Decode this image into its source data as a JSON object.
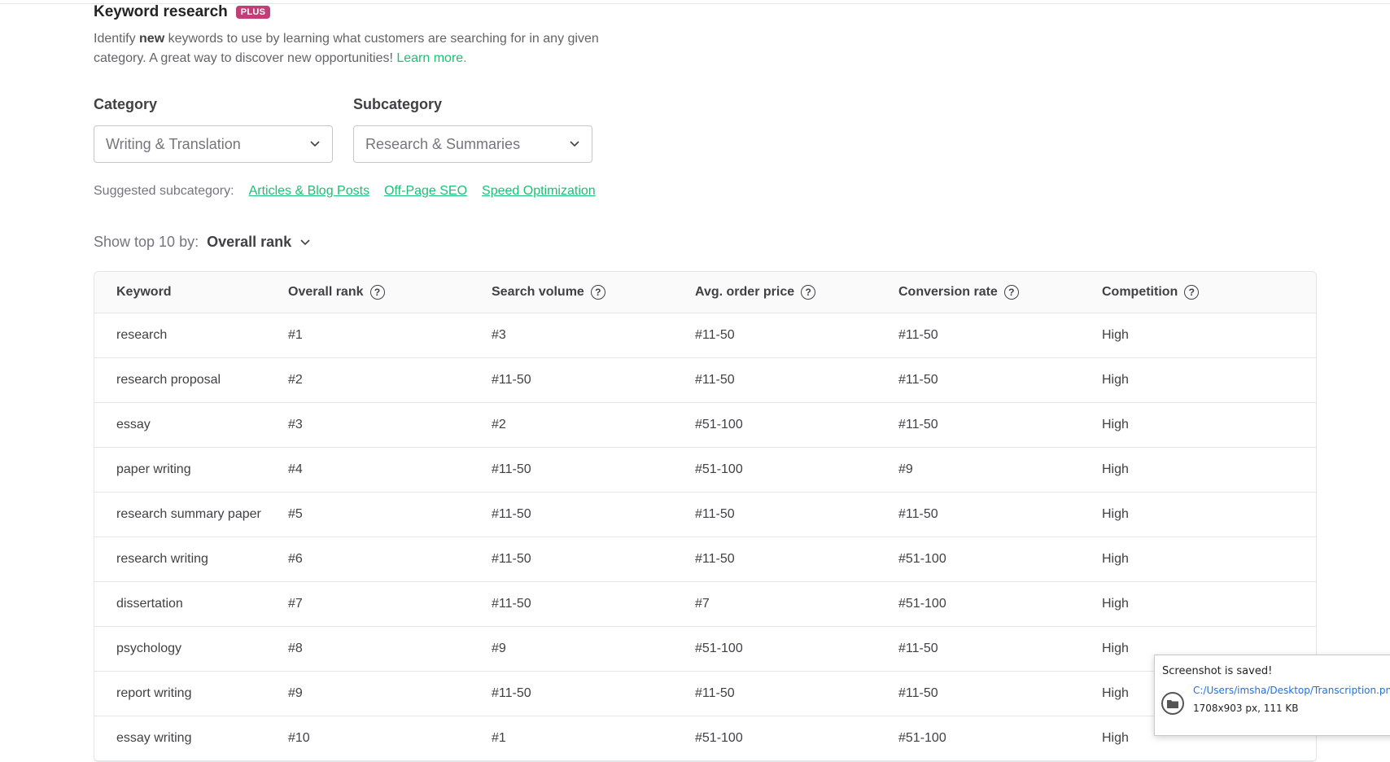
{
  "header": {
    "title": "Keyword research",
    "badge": "PLUS"
  },
  "description": {
    "part1": "Identify ",
    "bold": "new",
    "part2": " keywords to use by learning what customers are searching for in any given category. A great way to discover new opportunities! ",
    "learn_more": "Learn more."
  },
  "category": {
    "label": "Category",
    "value": "Writing & Translation"
  },
  "subcategory": {
    "label": "Subcategory",
    "value": "Research & Summaries"
  },
  "suggested": {
    "label": "Suggested subcategory:",
    "links": [
      "Articles & Blog Posts",
      "Off-Page SEO",
      "Speed Optimization"
    ]
  },
  "sort": {
    "label": "Show top 10 by:",
    "value": "Overall rank"
  },
  "table": {
    "columns": [
      "Keyword",
      "Overall rank",
      "Search volume",
      "Avg. order price",
      "Conversion rate",
      "Competition"
    ],
    "rows": [
      [
        "research",
        "#1",
        "#3",
        "#11-50",
        "#11-50",
        "High"
      ],
      [
        "research proposal",
        "#2",
        "#11-50",
        "#11-50",
        "#11-50",
        "High"
      ],
      [
        "essay",
        "#3",
        "#2",
        "#51-100",
        "#11-50",
        "High"
      ],
      [
        "paper writing",
        "#4",
        "#11-50",
        "#51-100",
        "#9",
        "High"
      ],
      [
        "research summary paper",
        "#5",
        "#11-50",
        "#11-50",
        "#11-50",
        "High"
      ],
      [
        "research writing",
        "#6",
        "#11-50",
        "#11-50",
        "#51-100",
        "High"
      ],
      [
        "dissertation",
        "#7",
        "#11-50",
        "#7",
        "#51-100",
        "High"
      ],
      [
        "psychology",
        "#8",
        "#9",
        "#51-100",
        "#11-50",
        "High"
      ],
      [
        "report writing",
        "#9",
        "#11-50",
        "#11-50",
        "#11-50",
        "High"
      ],
      [
        "essay writing",
        "#10",
        "#1",
        "#51-100",
        "#51-100",
        "High"
      ]
    ]
  },
  "toast": {
    "title": "Screenshot is saved!",
    "path": "C:/Users/imsha/Desktop/Transcription.png",
    "meta": "1708x903 px, 111 KB"
  },
  "colors": {
    "accent": "#1dbf73",
    "badge": "#c13e78",
    "text": "#404145",
    "muted": "#74767e"
  }
}
